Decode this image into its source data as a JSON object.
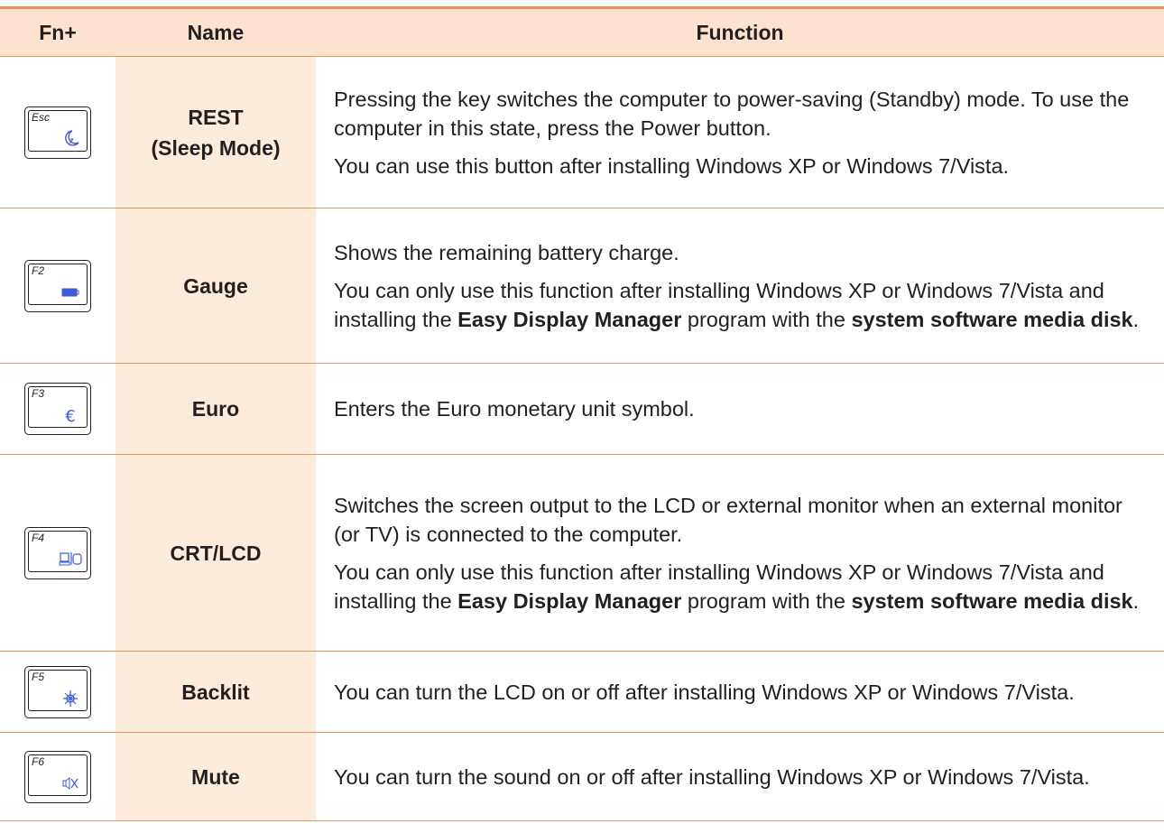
{
  "header": {
    "fn": "Fn+",
    "name": "Name",
    "function": "Function"
  },
  "rows": [
    {
      "key": {
        "label": "Esc",
        "icon": "moon-icon"
      },
      "name_lines": [
        "REST",
        "(Sleep Mode)"
      ],
      "paragraphs": [
        [
          {
            "t": "Pressing the key switches the computer to power-saving (Standby) mode. To use the computer in this state, press the Power button."
          }
        ],
        [
          {
            "t": "You can use this button after installing Windows XP or Windows 7/Vista."
          }
        ]
      ]
    },
    {
      "key": {
        "label": "F2",
        "icon": "battery-icon"
      },
      "name_lines": [
        "Gauge"
      ],
      "paragraphs": [
        [
          {
            "t": "Shows the remaining battery charge."
          }
        ],
        [
          {
            "t": "You can only use this function after installing Windows XP or Windows 7/Vista and installing the "
          },
          {
            "t": "Easy Display Manager",
            "b": true
          },
          {
            "t": " program with the "
          },
          {
            "t": "system software media disk",
            "b": true
          },
          {
            "t": "."
          }
        ]
      ]
    },
    {
      "key": {
        "label": "F3",
        "icon": "euro-icon"
      },
      "name_lines": [
        "Euro"
      ],
      "paragraphs": [
        [
          {
            "t": "Enters the Euro monetary unit symbol."
          }
        ]
      ]
    },
    {
      "key": {
        "label": "F4",
        "icon": "monitor-switch-icon"
      },
      "name_lines": [
        "CRT/LCD"
      ],
      "paragraphs": [
        [
          {
            "t": "Switches the screen output to the LCD or external monitor when an external monitor (or TV) is connected to the computer."
          }
        ],
        [
          {
            "t": "You can only use this function after installing Windows XP or Windows 7/Vista and installing the "
          },
          {
            "t": "Easy Display Manager",
            "b": true
          },
          {
            "t": " program with the "
          },
          {
            "t": "system software media disk",
            "b": true
          },
          {
            "t": "."
          }
        ]
      ]
    },
    {
      "key": {
        "label": "F5",
        "icon": "backlight-icon"
      },
      "name_lines": [
        "Backlit"
      ],
      "paragraphs": [
        [
          {
            "t": "You can turn the LCD on or off after installing Windows XP or Windows 7/Vista."
          }
        ]
      ]
    },
    {
      "key": {
        "label": "F6",
        "icon": "mute-icon"
      },
      "name_lines": [
        "Mute"
      ],
      "paragraphs": [
        [
          {
            "t": "You can turn the sound on or off after installing Windows XP or Windows 7/Vista."
          }
        ]
      ]
    }
  ],
  "colors": {
    "accent": "#e8945a",
    "header_bg": "#fde3cf",
    "name_bg": "#fdebdc",
    "icon": "#3b5bd9"
  }
}
